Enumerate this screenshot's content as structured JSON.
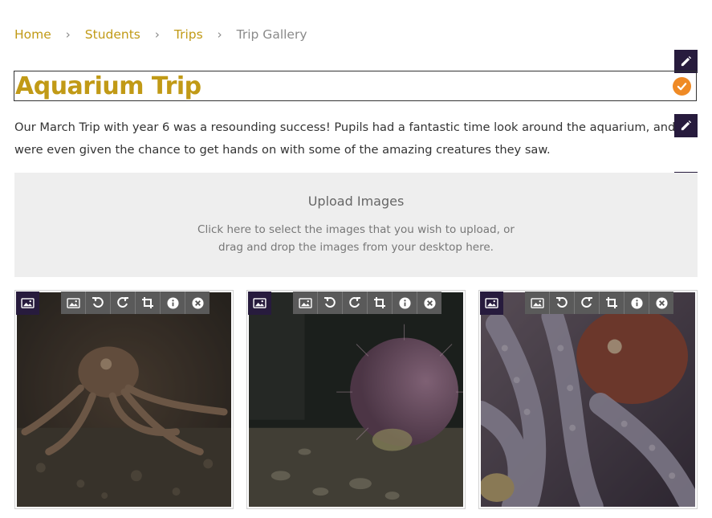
{
  "breadcrumb": {
    "items": [
      {
        "label": "Home"
      },
      {
        "label": "Students"
      },
      {
        "label": "Trips"
      }
    ],
    "current": "Trip Gallery",
    "separator": "›"
  },
  "page": {
    "title": "Aquarium Trip",
    "description": "Our March Trip with year 6 was a resounding success!  Pupils had a fantastic time look around the aquarium, and were even given the chance to get hands on with some of the amazing creatures they saw."
  },
  "upload": {
    "title": "Upload Images",
    "hint_line1": "Click here to select the images that you wish to upload, or",
    "hint_line2": "drag and drop the images from your desktop here."
  },
  "gallery": {
    "images": [
      {
        "subject": "octopus on sandy aquarium floor"
      },
      {
        "subject": "pink sea urchin on gravel"
      },
      {
        "subject": "close-up of octopus tentacles"
      }
    ],
    "tools": [
      "image-icon",
      "rotate-left-icon",
      "rotate-right-icon",
      "crop-icon",
      "info-icon",
      "remove-icon"
    ]
  },
  "colors": {
    "accent_gold": "#c19a16",
    "dark_purple": "#271b3d",
    "confirm_orange": "#ef8a25"
  }
}
